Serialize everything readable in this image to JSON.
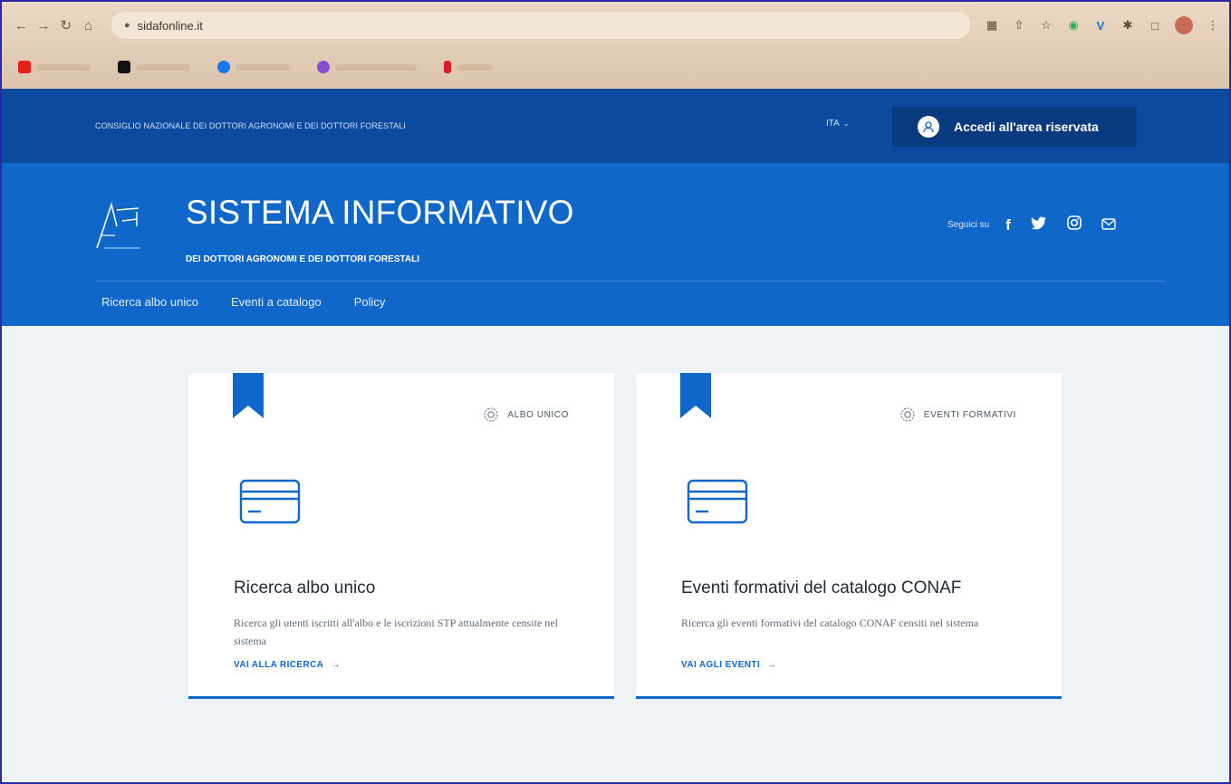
{
  "browser": {
    "url": "sidafonline.it",
    "bookmarks": [
      {
        "icon": "youtube-icon",
        "color": "#e62117"
      },
      {
        "icon": "x-icon",
        "color": "#111111"
      },
      {
        "icon": "facebook-icon",
        "color": "#1877f2"
      },
      {
        "icon": "bookmark-app-icon",
        "color": "#8a4bd3"
      },
      {
        "icon": "netflix-icon",
        "color": "#d81f26"
      }
    ]
  },
  "topbar": {
    "org_name": "CONSIGLIO NAZIONALE DEI DOTTORI AGRONOMI E DEI DOTTORI FORESTALI",
    "language": "ITA",
    "login_label": "Accedi all'area riservata"
  },
  "header": {
    "title": "SISTEMA INFORMATIVO",
    "subtitle": "DEI DOTTORI AGRONOMI E DEI DOTTORI FORESTALI",
    "social_label": "Seguici su",
    "social_icons": [
      "facebook-icon",
      "twitter-icon",
      "instagram-icon",
      "mail-icon"
    ]
  },
  "menu": [
    {
      "label": "Ricerca albo unico"
    },
    {
      "label": "Eventi a catalogo"
    },
    {
      "label": "Policy"
    }
  ],
  "cards": [
    {
      "category": "ALBO UNICO",
      "title": "Ricerca albo unico",
      "text": "Ricerca gli utenti iscritti all'albo e le iscrizioni STP attualmente censite nel sistema",
      "link": "VAI ALLA RICERCA"
    },
    {
      "category": "EVENTI FORMATIVI",
      "title": "Eventi formativi del catalogo CONAF",
      "text": "Ricerca gli eventi formativi del catalogo CONAF censiti nel sistema",
      "link": "VAI AGLI EVENTI"
    }
  ],
  "colors": {
    "topbar": "#0b4a9e",
    "header": "#0f67c9",
    "accent": "#0f67c9",
    "page_bg": "#eef3f8"
  }
}
